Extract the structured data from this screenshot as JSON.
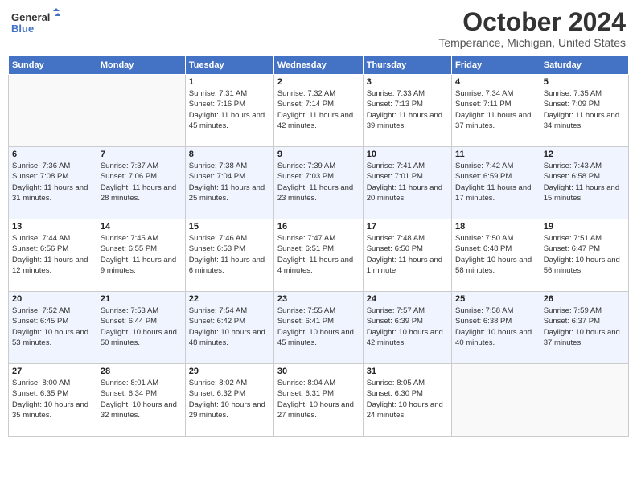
{
  "header": {
    "logo_line1": "General",
    "logo_line2": "Blue",
    "month": "October 2024",
    "location": "Temperance, Michigan, United States"
  },
  "days_of_week": [
    "Sunday",
    "Monday",
    "Tuesday",
    "Wednesday",
    "Thursday",
    "Friday",
    "Saturday"
  ],
  "weeks": [
    [
      {
        "day": "",
        "info": ""
      },
      {
        "day": "",
        "info": ""
      },
      {
        "day": "1",
        "info": "Sunrise: 7:31 AM\nSunset: 7:16 PM\nDaylight: 11 hours and 45 minutes."
      },
      {
        "day": "2",
        "info": "Sunrise: 7:32 AM\nSunset: 7:14 PM\nDaylight: 11 hours and 42 minutes."
      },
      {
        "day": "3",
        "info": "Sunrise: 7:33 AM\nSunset: 7:13 PM\nDaylight: 11 hours and 39 minutes."
      },
      {
        "day": "4",
        "info": "Sunrise: 7:34 AM\nSunset: 7:11 PM\nDaylight: 11 hours and 37 minutes."
      },
      {
        "day": "5",
        "info": "Sunrise: 7:35 AM\nSunset: 7:09 PM\nDaylight: 11 hours and 34 minutes."
      }
    ],
    [
      {
        "day": "6",
        "info": "Sunrise: 7:36 AM\nSunset: 7:08 PM\nDaylight: 11 hours and 31 minutes."
      },
      {
        "day": "7",
        "info": "Sunrise: 7:37 AM\nSunset: 7:06 PM\nDaylight: 11 hours and 28 minutes."
      },
      {
        "day": "8",
        "info": "Sunrise: 7:38 AM\nSunset: 7:04 PM\nDaylight: 11 hours and 25 minutes."
      },
      {
        "day": "9",
        "info": "Sunrise: 7:39 AM\nSunset: 7:03 PM\nDaylight: 11 hours and 23 minutes."
      },
      {
        "day": "10",
        "info": "Sunrise: 7:41 AM\nSunset: 7:01 PM\nDaylight: 11 hours and 20 minutes."
      },
      {
        "day": "11",
        "info": "Sunrise: 7:42 AM\nSunset: 6:59 PM\nDaylight: 11 hours and 17 minutes."
      },
      {
        "day": "12",
        "info": "Sunrise: 7:43 AM\nSunset: 6:58 PM\nDaylight: 11 hours and 15 minutes."
      }
    ],
    [
      {
        "day": "13",
        "info": "Sunrise: 7:44 AM\nSunset: 6:56 PM\nDaylight: 11 hours and 12 minutes."
      },
      {
        "day": "14",
        "info": "Sunrise: 7:45 AM\nSunset: 6:55 PM\nDaylight: 11 hours and 9 minutes."
      },
      {
        "day": "15",
        "info": "Sunrise: 7:46 AM\nSunset: 6:53 PM\nDaylight: 11 hours and 6 minutes."
      },
      {
        "day": "16",
        "info": "Sunrise: 7:47 AM\nSunset: 6:51 PM\nDaylight: 11 hours and 4 minutes."
      },
      {
        "day": "17",
        "info": "Sunrise: 7:48 AM\nSunset: 6:50 PM\nDaylight: 11 hours and 1 minute."
      },
      {
        "day": "18",
        "info": "Sunrise: 7:50 AM\nSunset: 6:48 PM\nDaylight: 10 hours and 58 minutes."
      },
      {
        "day": "19",
        "info": "Sunrise: 7:51 AM\nSunset: 6:47 PM\nDaylight: 10 hours and 56 minutes."
      }
    ],
    [
      {
        "day": "20",
        "info": "Sunrise: 7:52 AM\nSunset: 6:45 PM\nDaylight: 10 hours and 53 minutes."
      },
      {
        "day": "21",
        "info": "Sunrise: 7:53 AM\nSunset: 6:44 PM\nDaylight: 10 hours and 50 minutes."
      },
      {
        "day": "22",
        "info": "Sunrise: 7:54 AM\nSunset: 6:42 PM\nDaylight: 10 hours and 48 minutes."
      },
      {
        "day": "23",
        "info": "Sunrise: 7:55 AM\nSunset: 6:41 PM\nDaylight: 10 hours and 45 minutes."
      },
      {
        "day": "24",
        "info": "Sunrise: 7:57 AM\nSunset: 6:39 PM\nDaylight: 10 hours and 42 minutes."
      },
      {
        "day": "25",
        "info": "Sunrise: 7:58 AM\nSunset: 6:38 PM\nDaylight: 10 hours and 40 minutes."
      },
      {
        "day": "26",
        "info": "Sunrise: 7:59 AM\nSunset: 6:37 PM\nDaylight: 10 hours and 37 minutes."
      }
    ],
    [
      {
        "day": "27",
        "info": "Sunrise: 8:00 AM\nSunset: 6:35 PM\nDaylight: 10 hours and 35 minutes."
      },
      {
        "day": "28",
        "info": "Sunrise: 8:01 AM\nSunset: 6:34 PM\nDaylight: 10 hours and 32 minutes."
      },
      {
        "day": "29",
        "info": "Sunrise: 8:02 AM\nSunset: 6:32 PM\nDaylight: 10 hours and 29 minutes."
      },
      {
        "day": "30",
        "info": "Sunrise: 8:04 AM\nSunset: 6:31 PM\nDaylight: 10 hours and 27 minutes."
      },
      {
        "day": "31",
        "info": "Sunrise: 8:05 AM\nSunset: 6:30 PM\nDaylight: 10 hours and 24 minutes."
      },
      {
        "day": "",
        "info": ""
      },
      {
        "day": "",
        "info": ""
      }
    ]
  ]
}
